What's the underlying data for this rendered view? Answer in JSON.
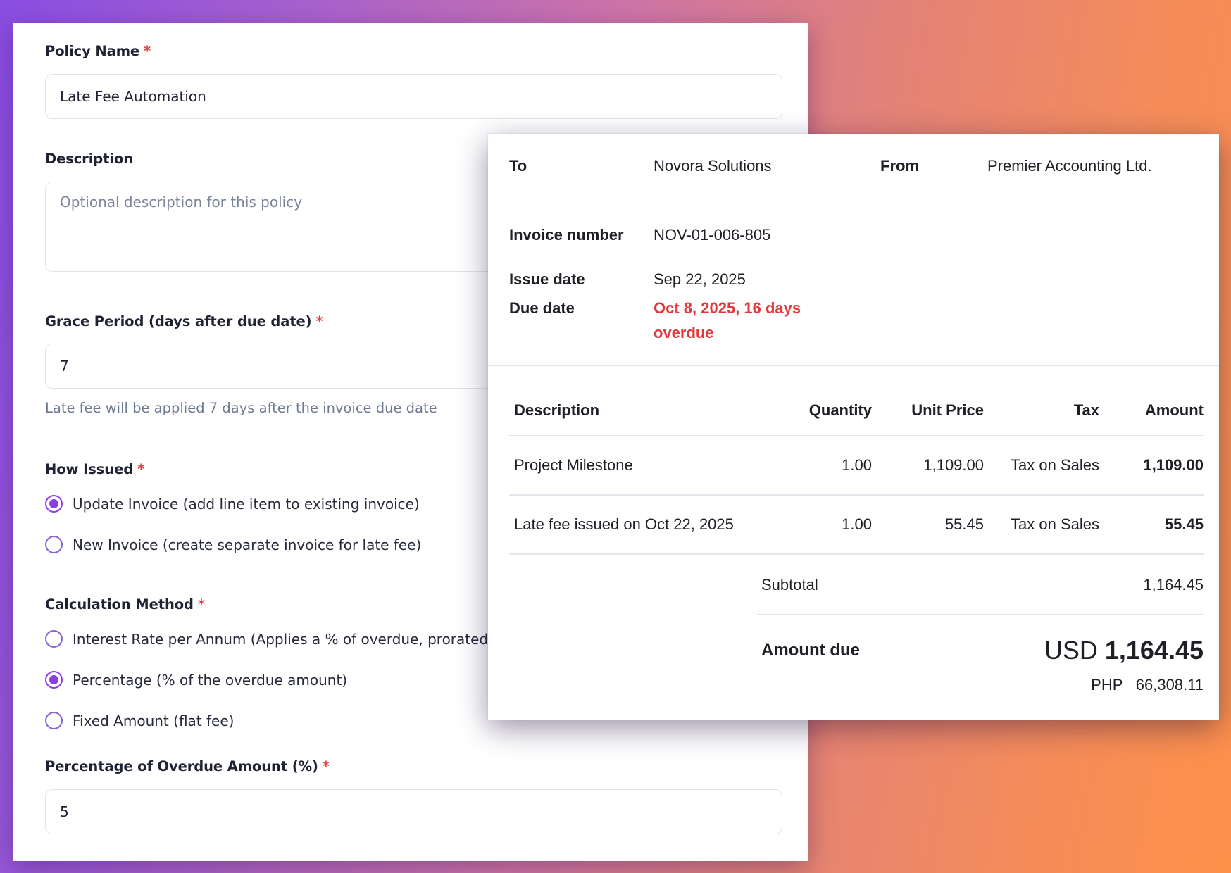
{
  "policy_form": {
    "policy_name": {
      "label": "Policy Name",
      "required_mark": "*",
      "value": "Late Fee Automation"
    },
    "description": {
      "label": "Description",
      "placeholder": "Optional description for this policy"
    },
    "grace_period": {
      "label": "Grace Period (days after due date)",
      "required_mark": "*",
      "value": "7",
      "helper": "Late fee will be applied 7 days after the invoice due date"
    },
    "how_issued": {
      "label": "How Issued",
      "required_mark": "*",
      "options": [
        {
          "label": "Update Invoice (add line item to existing invoice)",
          "selected": true
        },
        {
          "label": "New Invoice (create separate invoice for late fee)",
          "selected": false
        }
      ]
    },
    "calculation_method": {
      "label": "Calculation Method",
      "required_mark": "*",
      "options": [
        {
          "label": "Interest Rate per Annum (Applies a % of overdue, prorated",
          "selected": false
        },
        {
          "label": "Percentage (% of the overdue amount)",
          "selected": true
        },
        {
          "label": "Fixed Amount (flat fee)",
          "selected": false
        }
      ]
    },
    "percentage": {
      "label": "Percentage of Overdue Amount (%)",
      "required_mark": "*",
      "value": "5"
    }
  },
  "invoice": {
    "to_label": "To",
    "to_value": "Novora Solutions",
    "from_label": "From",
    "from_value": "Premier Accounting Ltd.",
    "invoice_number_label": "Invoice number",
    "invoice_number": "NOV-01-006-805",
    "issue_date_label": "Issue date",
    "issue_date": "Sep 22, 2025",
    "due_date_label": "Due date",
    "due_date_line1": "Oct 8, 2025, 16 days",
    "due_date_line2": "overdue",
    "columns": {
      "description": "Description",
      "quantity": "Quantity",
      "unit_price": "Unit Price",
      "tax": "Tax",
      "amount": "Amount"
    },
    "line_items": [
      {
        "description": "Project Milestone",
        "quantity": "1.00",
        "unit_price": "1,109.00",
        "tax": "Tax on Sales",
        "amount": "1,109.00"
      },
      {
        "description": "Late fee issued on Oct 22, 2025",
        "quantity": "1.00",
        "unit_price": "55.45",
        "tax": "Tax on Sales",
        "amount": "55.45"
      }
    ],
    "subtotal_label": "Subtotal",
    "subtotal": "1,164.45",
    "amount_due_label": "Amount due",
    "amount_due_currency": "USD",
    "amount_due": "1,164.45",
    "alt_currency": "PHP",
    "alt_amount": "66,308.11"
  },
  "colors": {
    "accent": "#8b3fe0",
    "required": "#e53e3e",
    "overdue": "#e03a3e"
  }
}
